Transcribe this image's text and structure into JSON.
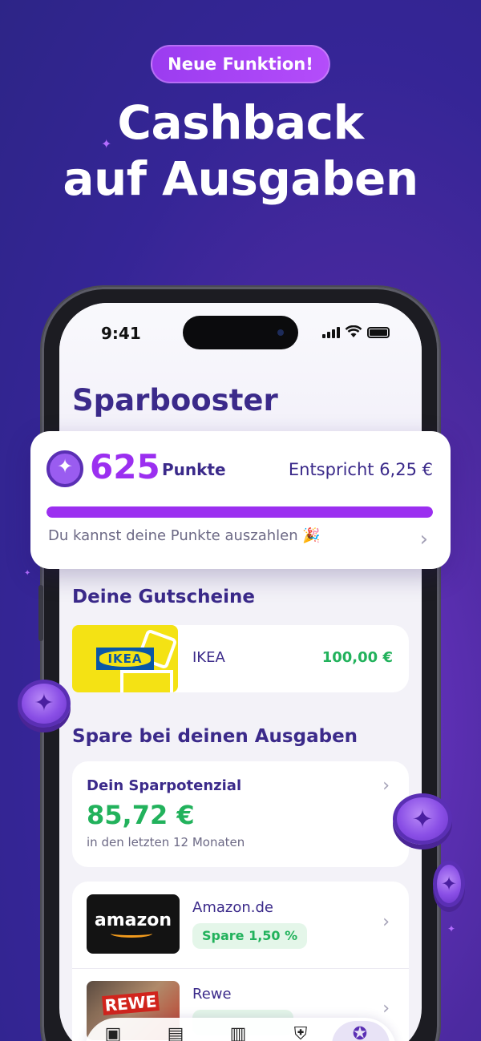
{
  "promo": {
    "badge": "Neue Funktion!",
    "headline_line1": "Cashback",
    "headline_line2": "auf Ausgaben"
  },
  "status_bar": {
    "time": "9:41"
  },
  "page": {
    "title": "Sparbooster"
  },
  "points": {
    "value": "625",
    "unit": "Punkte",
    "equivalent": "Entspricht 6,25 €",
    "progress_fraction": 1.0,
    "message": "Du kannst deine Punkte auszahlen 🎉"
  },
  "vouchers": {
    "section_title": "Deine Gutscheine",
    "items": [
      {
        "logo_text": "IKEA",
        "name": "IKEA",
        "amount": "100,00 €"
      }
    ]
  },
  "savings": {
    "section_title": "Spare bei deinen Ausgaben",
    "potential_label": "Dein Sparpotenzial",
    "potential_value": "85,72 €",
    "potential_sub": "in den letzten 12 Monaten",
    "shops": [
      {
        "logo_text": "amazon",
        "name": "Amazon.de",
        "save": "Spare 1,50 %"
      },
      {
        "logo_text": "REWE",
        "name": "Rewe",
        "save": ""
      }
    ]
  },
  "tabbar": {
    "icons": [
      "home-icon",
      "wallet-icon",
      "chart-icon",
      "shield-icon",
      "booster-icon"
    ],
    "active_index": 4
  },
  "colors": {
    "accent": "#9b2ff0",
    "heading": "#3b2a8a",
    "positive": "#22b25c",
    "background": "#352596"
  }
}
